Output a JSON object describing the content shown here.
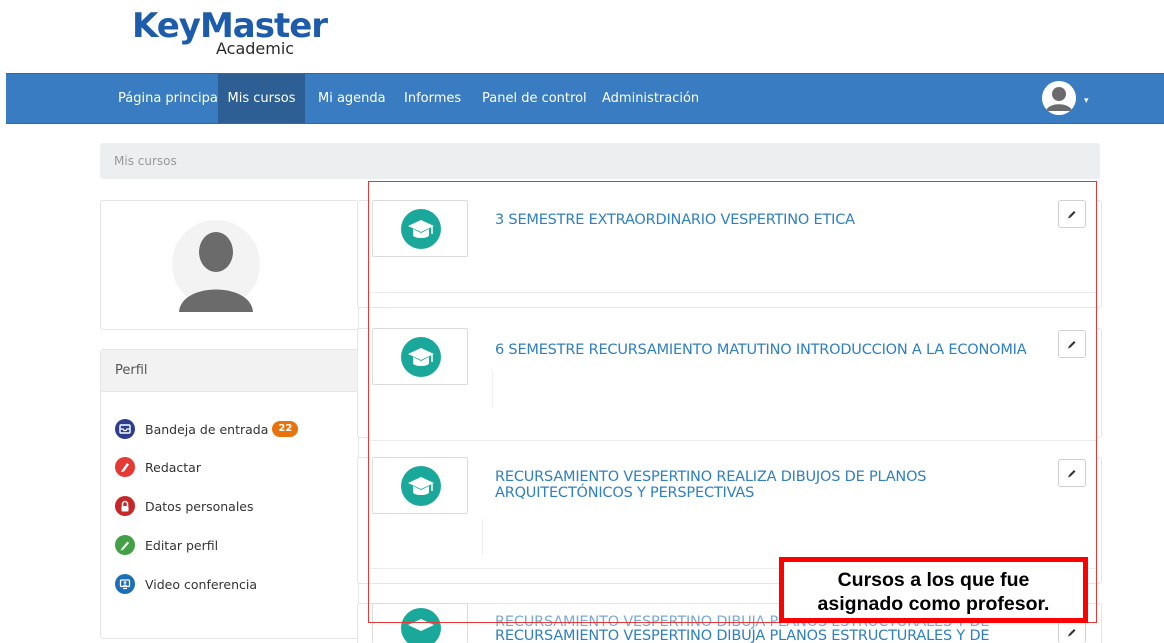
{
  "logo": {
    "main": "KeyMaster",
    "sub": "Academic"
  },
  "nav": {
    "items": [
      {
        "label": "Página principal",
        "active": false
      },
      {
        "label": "Mis cursos",
        "active": true
      },
      {
        "label": "Mi agenda",
        "active": false
      },
      {
        "label": "Informes",
        "active": false
      },
      {
        "label": "Panel de control",
        "active": false
      },
      {
        "label": "Administración",
        "active": false
      }
    ],
    "user_caret": "▾"
  },
  "breadcrumb": "Mis cursos",
  "sidebar": {
    "panel_title": "Perfil",
    "items": [
      {
        "label": "Bandeja de entrada",
        "icon": "inbox-icon",
        "color": "#2d3e8f",
        "badge": "22"
      },
      {
        "label": "Redactar",
        "icon": "compose-icon",
        "color": "#e53935"
      },
      {
        "label": "Datos personales",
        "icon": "lock-icon",
        "color": "#c62828"
      },
      {
        "label": "Editar perfil",
        "icon": "edit-pencil-icon",
        "color": "#43a047"
      },
      {
        "label": "Video conferencia",
        "icon": "video-conference-icon",
        "color": "#1e6fb8"
      }
    ]
  },
  "courses": [
    {
      "title": "3 SEMESTRE EXTRAORDINARIO VESPERTINO ETICA",
      "icon": "graduation-cap-icon"
    },
    {
      "title": "6 SEMESTRE RECURSAMIENTO MATUTINO INTRODUCCION A LA ECONOMIA",
      "icon": "graduation-cap-icon"
    },
    {
      "title": "RECURSAMIENTO VESPERTINO REALIZA DIBUJOS DE PLANOS ARQUITECTÓNICOS Y PERSPECTIVAS",
      "icon": "graduation-cap-icon"
    },
    {
      "title": "RECURSAMIENTO VESPERTINO DIBUJA PLANOS ESTRUCTURALES Y DE",
      "icon": "graduation-cap-icon"
    },
    {
      "title": "RECURSAMIENTO VESPERTINO DIBUJA PLANOS ESTRUCTURALES Y DE",
      "icon": "graduation-cap-icon"
    }
  ],
  "annotation": {
    "line1": "Cursos a los que fue",
    "line2": "asignado como profesor."
  },
  "colors": {
    "navbar": "#3a7cc2",
    "nav_active": "#2d5f95",
    "link": "#2f7fc1",
    "course_icon": "#1aa89a",
    "highlight": "#ff0000"
  }
}
